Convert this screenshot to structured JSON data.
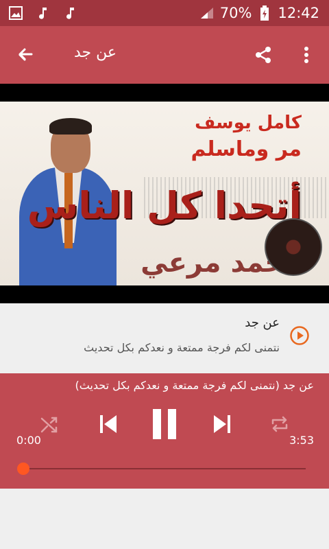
{
  "status_bar": {
    "battery": "70%",
    "time": "12:42",
    "icons": [
      "image-icon",
      "music-note-icon",
      "music-note-icon",
      "signal-icon",
      "battery-charging-icon"
    ]
  },
  "app_bar": {
    "title": "عن جد",
    "back_icon": "arrow-left-icon",
    "share_icon": "share-icon",
    "more_icon": "more-vert-icon"
  },
  "video": {
    "text_line1": "كامل يوسف",
    "text_line2": "مر وماسلم",
    "text_line3": "أتحدا كل الناس",
    "text_line4": "محمد مرعي"
  },
  "track": {
    "title": "عن جد",
    "subtitle": "نتمنى لكم فرجة ممتعة و نعدكم بكل تحديث",
    "play_icon": "play-circle-icon"
  },
  "player": {
    "now_playing": "عن جد (نتمنى لكم فرجة ممتعة و نعدكم بكل تحديث)",
    "time_current": "0:00",
    "time_total": "3:53",
    "progress": 0,
    "controls": [
      "shuffle-icon",
      "skip-previous-icon",
      "pause-icon",
      "skip-next-icon",
      "repeat-icon"
    ]
  },
  "colors": {
    "status_bar": "#a0353e",
    "app_bar": "#c04a52",
    "player": "#c04a52",
    "seek_thumb": "#ff5722",
    "play_icon": "#e8681f"
  }
}
